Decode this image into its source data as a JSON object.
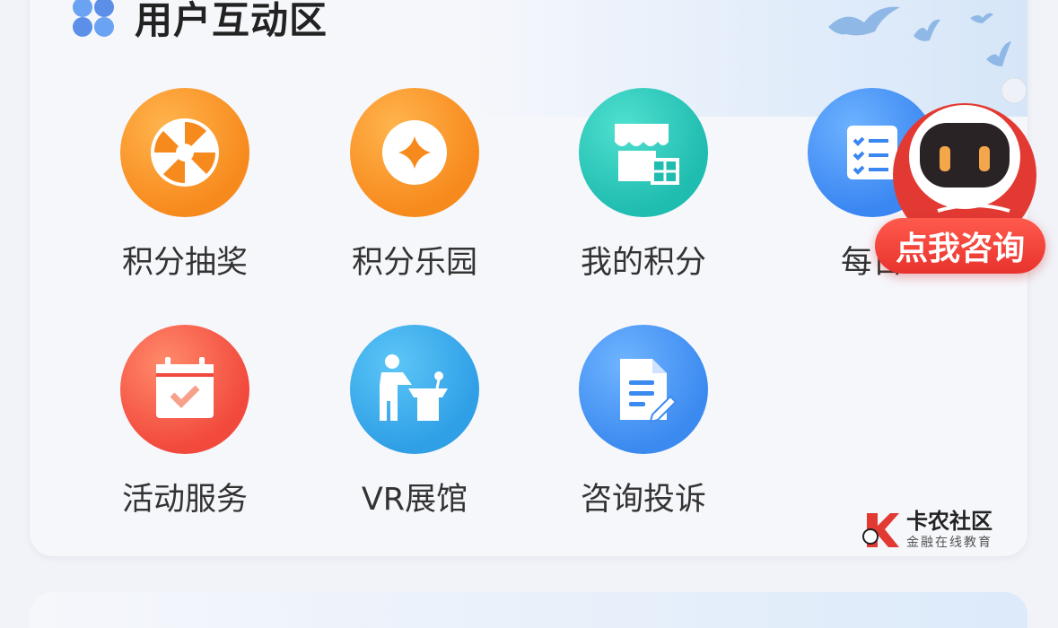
{
  "section": {
    "title": "用户互动区",
    "icon": "clover-icon"
  },
  "items": [
    {
      "label": "积分抽奖",
      "icon": "lottery-wheel-icon"
    },
    {
      "label": "积分乐园",
      "icon": "coin-icon"
    },
    {
      "label": "我的积分",
      "icon": "store-icon"
    },
    {
      "label": "每日",
      "icon": "checklist-icon"
    },
    {
      "label": "活动服务",
      "icon": "calendar-check-icon"
    },
    {
      "label": "VR展馆",
      "icon": "lecture-podium-icon"
    },
    {
      "label": "咨询投诉",
      "icon": "document-edit-icon"
    }
  ],
  "assistant": {
    "label": "点我咨询",
    "icon": "robot-icon"
  },
  "watermark": {
    "brand": "卡农社区",
    "tagline": "金融在线教育"
  },
  "colors": {
    "orange": "#f78a1d",
    "teal": "#1fbcb0",
    "blue": "#3a86f2",
    "red": "#f2493d",
    "accent": "#e8332d"
  }
}
